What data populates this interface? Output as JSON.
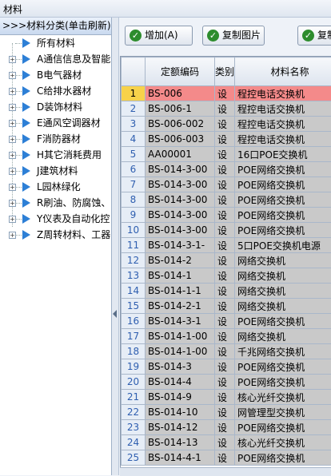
{
  "window": {
    "title": "材料"
  },
  "sidebar": {
    "header": ">>>材料分类(单击刷新)",
    "items": [
      {
        "label": "所有材料"
      },
      {
        "label": "A通信信息及智能"
      },
      {
        "label": "B电气器材"
      },
      {
        "label": "C给排水器材"
      },
      {
        "label": "D装饰材料"
      },
      {
        "label": "E通风空调器材"
      },
      {
        "label": "F消防器材"
      },
      {
        "label": "H其它消耗费用"
      },
      {
        "label": "J建筑材料"
      },
      {
        "label": "L园林绿化"
      },
      {
        "label": "R刷油、防腐蚀、"
      },
      {
        "label": "Y仪表及自动化控"
      },
      {
        "label": "Z周转材料、工器"
      }
    ]
  },
  "toolbar": {
    "add_label": "增加(A)",
    "copy_image_label": "复制图片",
    "copy_label": "复制"
  },
  "table": {
    "columns": [
      "",
      "定额编码",
      "类别",
      "材料名称"
    ],
    "rows": [
      [
        "1",
        "BS-006",
        "设",
        "程控电话交换机"
      ],
      [
        "2",
        "BS-006-1",
        "设",
        "程控电话交换机"
      ],
      [
        "3",
        "BS-006-002",
        "设",
        "程控电话交换机"
      ],
      [
        "4",
        "BS-006-003",
        "设",
        "程控电话交换机"
      ],
      [
        "5",
        "AA00001",
        "设",
        "16口POE交换机"
      ],
      [
        "6",
        "BS-014-3-00",
        "设",
        "POE网络交换机"
      ],
      [
        "7",
        "BS-014-3-00",
        "设",
        "POE网络交换机"
      ],
      [
        "8",
        "BS-014-3-00",
        "设",
        "POE网络交换机"
      ],
      [
        "9",
        "BS-014-3-00",
        "设",
        "POE网络交换机"
      ],
      [
        "10",
        "BS-014-3-00",
        "设",
        "POE网络交换机"
      ],
      [
        "11",
        "BS-014-3-1-",
        "设",
        "5口POE交换机电源"
      ],
      [
        "12",
        "BS-014-2",
        "设",
        "网络交换机"
      ],
      [
        "13",
        "BS-014-1",
        "设",
        "网络交换机"
      ],
      [
        "14",
        "BS-014-1-1",
        "设",
        "网络交换机"
      ],
      [
        "15",
        "BS-014-2-1",
        "设",
        "网络交换机"
      ],
      [
        "16",
        "BS-014-3-1",
        "设",
        "POE网络交换机"
      ],
      [
        "17",
        "BS-014-1-00",
        "设",
        "网络交换机"
      ],
      [
        "18",
        "BS-014-1-00",
        "设",
        "千兆网络交换机"
      ],
      [
        "19",
        "BS-014-3",
        "设",
        "POE网络交换机"
      ],
      [
        "20",
        "BS-014-4",
        "设",
        "POE网络交换机"
      ],
      [
        "21",
        "BS-014-9",
        "设",
        "核心光纤交换机"
      ],
      [
        "22",
        "BS-014-10",
        "设",
        "网管理型交换机"
      ],
      [
        "23",
        "BS-014-12",
        "设",
        "POE网络交换机"
      ],
      [
        "24",
        "BS-014-13",
        "设",
        "核心光纤交换机"
      ],
      [
        "25",
        "BS-014-4-1",
        "设",
        "POE网络交换机"
      ]
    ]
  }
}
